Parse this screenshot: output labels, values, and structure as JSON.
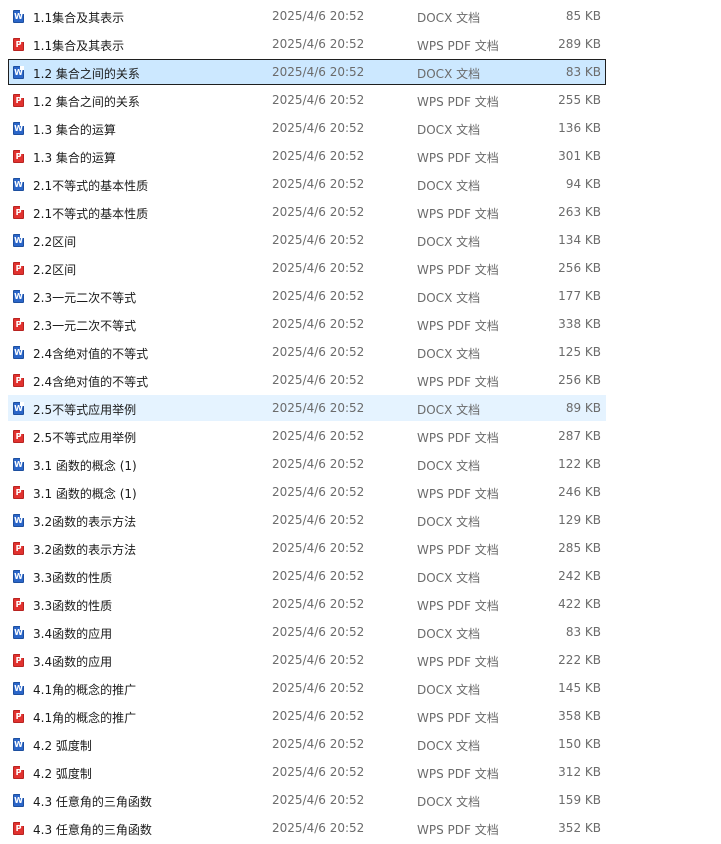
{
  "colors": {
    "selected_bg": "#cce8ff",
    "hover_bg": "#e5f3ff",
    "docx_icon": "#2b66c9",
    "pdf_icon": "#e1322f"
  },
  "files": [
    {
      "name": "1.1集合及其表示",
      "date": "2025/4/6 20:52",
      "type": "DOCX 文档",
      "size": "85 KB",
      "icon": "word-doc-icon",
      "state": ""
    },
    {
      "name": "1.1集合及其表示",
      "date": "2025/4/6 20:52",
      "type": "WPS PDF 文档",
      "size": "289 KB",
      "icon": "pdf-icon",
      "state": ""
    },
    {
      "name": "1.2 集合之间的关系",
      "date": "2025/4/6 20:52",
      "type": "DOCX 文档",
      "size": "83 KB",
      "icon": "word-doc-icon",
      "state": "selected"
    },
    {
      "name": "1.2 集合之间的关系",
      "date": "2025/4/6 20:52",
      "type": "WPS PDF 文档",
      "size": "255 KB",
      "icon": "pdf-icon",
      "state": ""
    },
    {
      "name": "1.3 集合的运算",
      "date": "2025/4/6 20:52",
      "type": "DOCX 文档",
      "size": "136 KB",
      "icon": "word-doc-icon",
      "state": ""
    },
    {
      "name": "1.3 集合的运算",
      "date": "2025/4/6 20:52",
      "type": "WPS PDF 文档",
      "size": "301 KB",
      "icon": "pdf-icon",
      "state": ""
    },
    {
      "name": "2.1不等式的基本性质",
      "date": "2025/4/6 20:52",
      "type": "DOCX 文档",
      "size": "94 KB",
      "icon": "word-doc-icon",
      "state": ""
    },
    {
      "name": "2.1不等式的基本性质",
      "date": "2025/4/6 20:52",
      "type": "WPS PDF 文档",
      "size": "263 KB",
      "icon": "pdf-icon",
      "state": ""
    },
    {
      "name": "2.2区间",
      "date": "2025/4/6 20:52",
      "type": "DOCX 文档",
      "size": "134 KB",
      "icon": "word-doc-icon",
      "state": ""
    },
    {
      "name": "2.2区间",
      "date": "2025/4/6 20:52",
      "type": "WPS PDF 文档",
      "size": "256 KB",
      "icon": "pdf-icon",
      "state": ""
    },
    {
      "name": "2.3一元二次不等式",
      "date": "2025/4/6 20:52",
      "type": "DOCX 文档",
      "size": "177 KB",
      "icon": "word-doc-icon",
      "state": ""
    },
    {
      "name": "2.3一元二次不等式",
      "date": "2025/4/6 20:52",
      "type": "WPS PDF 文档",
      "size": "338 KB",
      "icon": "pdf-icon",
      "state": ""
    },
    {
      "name": "2.4含绝对值的不等式",
      "date": "2025/4/6 20:52",
      "type": "DOCX 文档",
      "size": "125 KB",
      "icon": "word-doc-icon",
      "state": ""
    },
    {
      "name": "2.4含绝对值的不等式",
      "date": "2025/4/6 20:52",
      "type": "WPS PDF 文档",
      "size": "256 KB",
      "icon": "pdf-icon",
      "state": ""
    },
    {
      "name": "2.5不等式应用举例",
      "date": "2025/4/6 20:52",
      "type": "DOCX 文档",
      "size": "89 KB",
      "icon": "word-doc-icon",
      "state": "hover"
    },
    {
      "name": "2.5不等式应用举例",
      "date": "2025/4/6 20:52",
      "type": "WPS PDF 文档",
      "size": "287 KB",
      "icon": "pdf-icon",
      "state": ""
    },
    {
      "name": "3.1 函数的概念 (1)",
      "date": "2025/4/6 20:52",
      "type": "DOCX 文档",
      "size": "122 KB",
      "icon": "word-doc-icon",
      "state": ""
    },
    {
      "name": "3.1 函数的概念 (1)",
      "date": "2025/4/6 20:52",
      "type": "WPS PDF 文档",
      "size": "246 KB",
      "icon": "pdf-icon",
      "state": ""
    },
    {
      "name": "3.2函数的表示方法",
      "date": "2025/4/6 20:52",
      "type": "DOCX 文档",
      "size": "129 KB",
      "icon": "word-doc-icon",
      "state": ""
    },
    {
      "name": "3.2函数的表示方法",
      "date": "2025/4/6 20:52",
      "type": "WPS PDF 文档",
      "size": "285 KB",
      "icon": "pdf-icon",
      "state": ""
    },
    {
      "name": "3.3函数的性质",
      "date": "2025/4/6 20:52",
      "type": "DOCX 文档",
      "size": "242 KB",
      "icon": "word-doc-icon",
      "state": ""
    },
    {
      "name": "3.3函数的性质",
      "date": "2025/4/6 20:52",
      "type": "WPS PDF 文档",
      "size": "422 KB",
      "icon": "pdf-icon",
      "state": ""
    },
    {
      "name": "3.4函数的应用",
      "date": "2025/4/6 20:52",
      "type": "DOCX 文档",
      "size": "83 KB",
      "icon": "word-doc-icon",
      "state": ""
    },
    {
      "name": "3.4函数的应用",
      "date": "2025/4/6 20:52",
      "type": "WPS PDF 文档",
      "size": "222 KB",
      "icon": "pdf-icon",
      "state": ""
    },
    {
      "name": "4.1角的概念的推广",
      "date": "2025/4/6 20:52",
      "type": "DOCX 文档",
      "size": "145 KB",
      "icon": "word-doc-icon",
      "state": ""
    },
    {
      "name": "4.1角的概念的推广",
      "date": "2025/4/6 20:52",
      "type": "WPS PDF 文档",
      "size": "358 KB",
      "icon": "pdf-icon",
      "state": ""
    },
    {
      "name": "4.2 弧度制",
      "date": "2025/4/6 20:52",
      "type": "DOCX 文档",
      "size": "150 KB",
      "icon": "word-doc-icon",
      "state": ""
    },
    {
      "name": "4.2 弧度制",
      "date": "2025/4/6 20:52",
      "type": "WPS PDF 文档",
      "size": "312 KB",
      "icon": "pdf-icon",
      "state": ""
    },
    {
      "name": "4.3 任意角的三角函数",
      "date": "2025/4/6 20:52",
      "type": "DOCX 文档",
      "size": "159 KB",
      "icon": "word-doc-icon",
      "state": ""
    },
    {
      "name": "4.3 任意角的三角函数",
      "date": "2025/4/6 20:52",
      "type": "WPS PDF 文档",
      "size": "352 KB",
      "icon": "pdf-icon",
      "state": ""
    }
  ]
}
